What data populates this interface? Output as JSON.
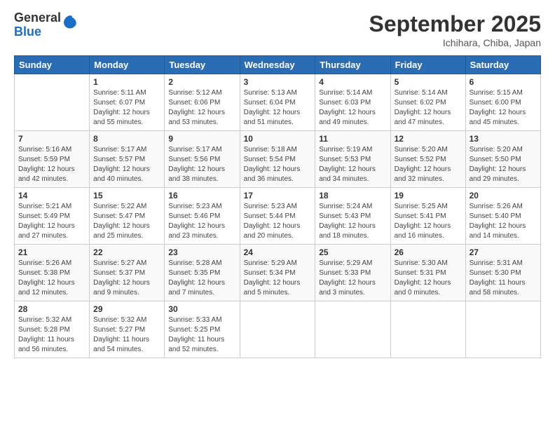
{
  "header": {
    "logo": {
      "general": "General",
      "blue": "Blue"
    },
    "title": "September 2025",
    "location": "Ichihara, Chiba, Japan"
  },
  "calendar": {
    "days_of_week": [
      "Sunday",
      "Monday",
      "Tuesday",
      "Wednesday",
      "Thursday",
      "Friday",
      "Saturday"
    ],
    "weeks": [
      [
        {
          "day": "",
          "info": ""
        },
        {
          "day": "1",
          "info": "Sunrise: 5:11 AM\nSunset: 6:07 PM\nDaylight: 12 hours\nand 55 minutes."
        },
        {
          "day": "2",
          "info": "Sunrise: 5:12 AM\nSunset: 6:06 PM\nDaylight: 12 hours\nand 53 minutes."
        },
        {
          "day": "3",
          "info": "Sunrise: 5:13 AM\nSunset: 6:04 PM\nDaylight: 12 hours\nand 51 minutes."
        },
        {
          "day": "4",
          "info": "Sunrise: 5:14 AM\nSunset: 6:03 PM\nDaylight: 12 hours\nand 49 minutes."
        },
        {
          "day": "5",
          "info": "Sunrise: 5:14 AM\nSunset: 6:02 PM\nDaylight: 12 hours\nand 47 minutes."
        },
        {
          "day": "6",
          "info": "Sunrise: 5:15 AM\nSunset: 6:00 PM\nDaylight: 12 hours\nand 45 minutes."
        }
      ],
      [
        {
          "day": "7",
          "info": "Sunrise: 5:16 AM\nSunset: 5:59 PM\nDaylight: 12 hours\nand 42 minutes."
        },
        {
          "day": "8",
          "info": "Sunrise: 5:17 AM\nSunset: 5:57 PM\nDaylight: 12 hours\nand 40 minutes."
        },
        {
          "day": "9",
          "info": "Sunrise: 5:17 AM\nSunset: 5:56 PM\nDaylight: 12 hours\nand 38 minutes."
        },
        {
          "day": "10",
          "info": "Sunrise: 5:18 AM\nSunset: 5:54 PM\nDaylight: 12 hours\nand 36 minutes."
        },
        {
          "day": "11",
          "info": "Sunrise: 5:19 AM\nSunset: 5:53 PM\nDaylight: 12 hours\nand 34 minutes."
        },
        {
          "day": "12",
          "info": "Sunrise: 5:20 AM\nSunset: 5:52 PM\nDaylight: 12 hours\nand 32 minutes."
        },
        {
          "day": "13",
          "info": "Sunrise: 5:20 AM\nSunset: 5:50 PM\nDaylight: 12 hours\nand 29 minutes."
        }
      ],
      [
        {
          "day": "14",
          "info": "Sunrise: 5:21 AM\nSunset: 5:49 PM\nDaylight: 12 hours\nand 27 minutes."
        },
        {
          "day": "15",
          "info": "Sunrise: 5:22 AM\nSunset: 5:47 PM\nDaylight: 12 hours\nand 25 minutes."
        },
        {
          "day": "16",
          "info": "Sunrise: 5:23 AM\nSunset: 5:46 PM\nDaylight: 12 hours\nand 23 minutes."
        },
        {
          "day": "17",
          "info": "Sunrise: 5:23 AM\nSunset: 5:44 PM\nDaylight: 12 hours\nand 20 minutes."
        },
        {
          "day": "18",
          "info": "Sunrise: 5:24 AM\nSunset: 5:43 PM\nDaylight: 12 hours\nand 18 minutes."
        },
        {
          "day": "19",
          "info": "Sunrise: 5:25 AM\nSunset: 5:41 PM\nDaylight: 12 hours\nand 16 minutes."
        },
        {
          "day": "20",
          "info": "Sunrise: 5:26 AM\nSunset: 5:40 PM\nDaylight: 12 hours\nand 14 minutes."
        }
      ],
      [
        {
          "day": "21",
          "info": "Sunrise: 5:26 AM\nSunset: 5:38 PM\nDaylight: 12 hours\nand 12 minutes."
        },
        {
          "day": "22",
          "info": "Sunrise: 5:27 AM\nSunset: 5:37 PM\nDaylight: 12 hours\nand 9 minutes."
        },
        {
          "day": "23",
          "info": "Sunrise: 5:28 AM\nSunset: 5:35 PM\nDaylight: 12 hours\nand 7 minutes."
        },
        {
          "day": "24",
          "info": "Sunrise: 5:29 AM\nSunset: 5:34 PM\nDaylight: 12 hours\nand 5 minutes."
        },
        {
          "day": "25",
          "info": "Sunrise: 5:29 AM\nSunset: 5:33 PM\nDaylight: 12 hours\nand 3 minutes."
        },
        {
          "day": "26",
          "info": "Sunrise: 5:30 AM\nSunset: 5:31 PM\nDaylight: 12 hours\nand 0 minutes."
        },
        {
          "day": "27",
          "info": "Sunrise: 5:31 AM\nSunset: 5:30 PM\nDaylight: 11 hours\nand 58 minutes."
        }
      ],
      [
        {
          "day": "28",
          "info": "Sunrise: 5:32 AM\nSunset: 5:28 PM\nDaylight: 11 hours\nand 56 minutes."
        },
        {
          "day": "29",
          "info": "Sunrise: 5:32 AM\nSunset: 5:27 PM\nDaylight: 11 hours\nand 54 minutes."
        },
        {
          "day": "30",
          "info": "Sunrise: 5:33 AM\nSunset: 5:25 PM\nDaylight: 11 hours\nand 52 minutes."
        },
        {
          "day": "",
          "info": ""
        },
        {
          "day": "",
          "info": ""
        },
        {
          "day": "",
          "info": ""
        },
        {
          "day": "",
          "info": ""
        }
      ]
    ]
  }
}
